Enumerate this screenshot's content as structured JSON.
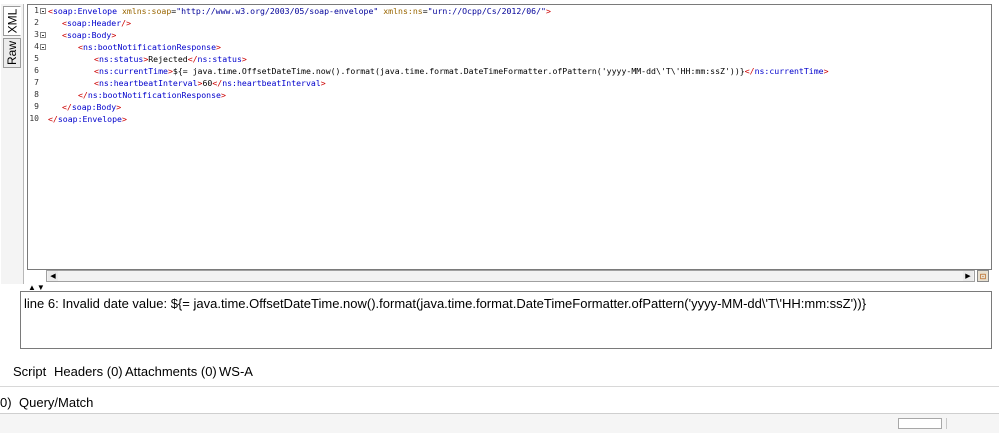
{
  "side_tabs": {
    "xml": "XML",
    "raw": "Raw"
  },
  "editor": {
    "lines": [
      {
        "n": "1"
      },
      {
        "n": "2"
      },
      {
        "n": "3"
      },
      {
        "n": "4"
      },
      {
        "n": "5"
      },
      {
        "n": "6"
      },
      {
        "n": "7"
      },
      {
        "n": "8"
      },
      {
        "n": "9"
      },
      {
        "n": "10"
      }
    ],
    "envelope_open": "soap:Envelope",
    "attr1": "xmlns:soap",
    "val1": "\"http://www.w3.org/2003/05/soap-envelope\"",
    "attr2": "xmlns:ns",
    "val2": "\"urn://Ocpp/Cs/2012/06/\"",
    "header": "soap:Header",
    "body": "soap:Body",
    "boot_resp": "ns:bootNotificationResponse",
    "status_tag": "ns:status",
    "status_value": "Rejected",
    "current_time_tag": "ns:currentTime",
    "current_time_value": "${= java.time.OffsetDateTime.now().format(java.time.format.DateTimeFormatter.ofPattern('yyyy-MM-dd\\'T\\'HH:mm:ssZ'))}",
    "heartbeat_tag": "ns:heartbeatInterval",
    "heartbeat_value": "60"
  },
  "message": "line 6: Invalid date value: ${= java.time.OffsetDateTime.now().format(java.time.format.DateTimeFormatter.ofPattern('yyyy-MM-dd\\'T\\'HH:mm:ssZ'))}",
  "bottom_tabs": [
    "Script",
    "Headers (0)",
    "Attachments (0)",
    "WS-A"
  ],
  "query": {
    "prefix": "0)",
    "label": "Query/Match"
  }
}
